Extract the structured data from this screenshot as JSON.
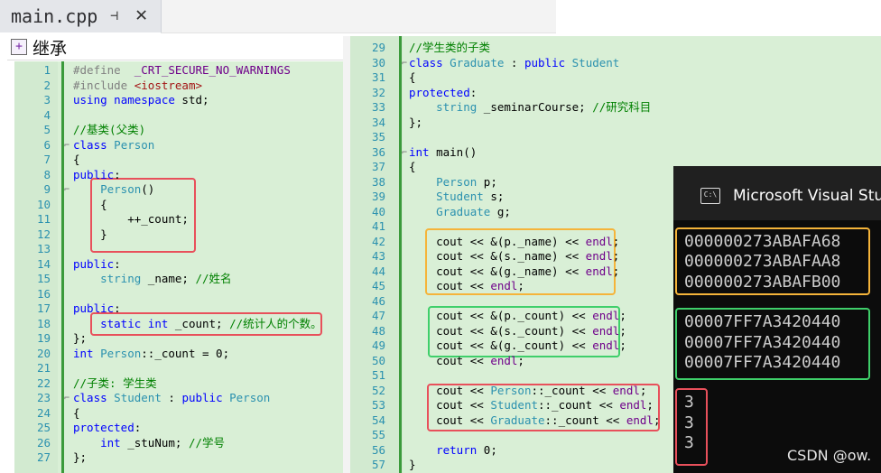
{
  "tab": {
    "title": "main.cpp",
    "pin_glyph": "⊣",
    "close_glyph": "✕"
  },
  "section": {
    "icon": "+",
    "label": "继承"
  },
  "left_lines": [
    {
      "n": "1",
      "code": "#define  _CRT_SECURE_NO_WARNINGS"
    },
    {
      "n": "2",
      "code": "#include <iostream>"
    },
    {
      "n": "3",
      "code": "using namespace std;"
    },
    {
      "n": "4",
      "code": ""
    },
    {
      "n": "5",
      "code": "//基类(父类)"
    },
    {
      "n": "6",
      "code": "class Person"
    },
    {
      "n": "7",
      "code": "{"
    },
    {
      "n": "8",
      "code": "public:"
    },
    {
      "n": "9",
      "code": "    Person()"
    },
    {
      "n": "10",
      "code": "    {"
    },
    {
      "n": "11",
      "code": "        ++_count;"
    },
    {
      "n": "12",
      "code": "    }"
    },
    {
      "n": "13",
      "code": ""
    },
    {
      "n": "14",
      "code": "public:"
    },
    {
      "n": "15",
      "code": "    string _name; //姓名"
    },
    {
      "n": "16",
      "code": ""
    },
    {
      "n": "17",
      "code": "public:"
    },
    {
      "n": "18",
      "code": "    static int _count; //统计人的个数。"
    },
    {
      "n": "19",
      "code": "};"
    },
    {
      "n": "20",
      "code": "int Person::_count = 0;"
    },
    {
      "n": "21",
      "code": ""
    },
    {
      "n": "22",
      "code": "//子类: 学生类"
    },
    {
      "n": "23",
      "code": "class Student : public Person"
    },
    {
      "n": "24",
      "code": "{"
    },
    {
      "n": "25",
      "code": "protected:"
    },
    {
      "n": "26",
      "code": "    int _stuNum; //学号"
    },
    {
      "n": "27",
      "code": "};"
    }
  ],
  "right_lines": [
    {
      "n": "29",
      "code": "//学生类的子类"
    },
    {
      "n": "30",
      "code": "class Graduate : public Student"
    },
    {
      "n": "31",
      "code": "{"
    },
    {
      "n": "32",
      "code": "protected:"
    },
    {
      "n": "33",
      "code": "    string _seminarCourse; //研究科目"
    },
    {
      "n": "34",
      "code": "};"
    },
    {
      "n": "35",
      "code": ""
    },
    {
      "n": "36",
      "code": "int main()"
    },
    {
      "n": "37",
      "code": "{"
    },
    {
      "n": "38",
      "code": "    Person p;"
    },
    {
      "n": "39",
      "code": "    Student s;"
    },
    {
      "n": "40",
      "code": "    Graduate g;"
    },
    {
      "n": "41",
      "code": ""
    },
    {
      "n": "42",
      "code": "    cout << &(p._name) << endl;"
    },
    {
      "n": "43",
      "code": "    cout << &(s._name) << endl;"
    },
    {
      "n": "44",
      "code": "    cout << &(g._name) << endl;"
    },
    {
      "n": "45",
      "code": "    cout << endl;"
    },
    {
      "n": "46",
      "code": ""
    },
    {
      "n": "47",
      "code": "    cout << &(p._count) << endl;"
    },
    {
      "n": "48",
      "code": "    cout << &(s._count) << endl;"
    },
    {
      "n": "49",
      "code": "    cout << &(g._count) << endl;"
    },
    {
      "n": "50",
      "code": "    cout << endl;"
    },
    {
      "n": "51",
      "code": ""
    },
    {
      "n": "52",
      "code": "    cout << Person::_count << endl;"
    },
    {
      "n": "53",
      "code": "    cout << Student::_count << endl;"
    },
    {
      "n": "54",
      "code": "    cout << Graduate::_count << endl;"
    },
    {
      "n": "55",
      "code": ""
    },
    {
      "n": "56",
      "code": "    return 0;"
    },
    {
      "n": "57",
      "code": "}"
    }
  ],
  "console": {
    "title": "Microsoft Visual Stu",
    "icon": "C:\\",
    "lines": [
      "000000273ABAFA68",
      "000000273ABAFAA8",
      "000000273ABAFB00",
      "",
      "00007FF7A3420440",
      "00007FF7A3420440",
      "00007FF7A3420440",
      "",
      "3",
      "3",
      "3"
    ]
  },
  "watermark": "CSDN @ow.",
  "colors": {
    "highlight_red": "#e8505b",
    "highlight_orange": "#f5b43a",
    "highlight_green": "#3fcf6a",
    "editor_bg": "#d9efd6"
  }
}
